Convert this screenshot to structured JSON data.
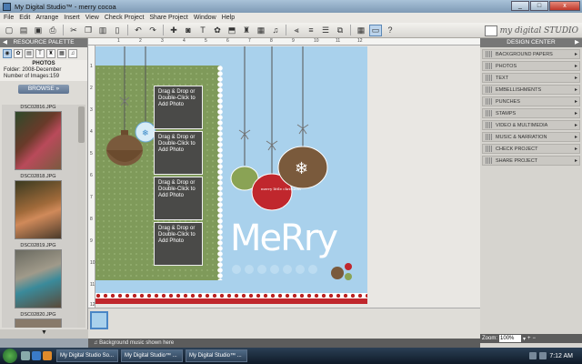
{
  "window": {
    "title": "My Digital Studio™ - merry cocoa"
  },
  "menu": [
    "File",
    "Edit",
    "Arrange",
    "Insert",
    "View",
    "Check Project",
    "Share Project",
    "Window",
    "Help"
  ],
  "window_buttons": {
    "minimize": "_",
    "maximize": "□",
    "close": "x"
  },
  "brand": {
    "text": "my digital STUDIO"
  },
  "resource_palette": {
    "title": "RESOURCE PALETTE",
    "section": "PHOTOS",
    "folder": "Folder: 2008-December",
    "count": "Number of Images:159",
    "browse_label": "BROWSE",
    "photos": [
      {
        "name": "DSC02816.JPG",
        "color": "#5a3a2a"
      },
      {
        "name": "DSC02818.JPG",
        "color": "#6a4a30"
      },
      {
        "name": "DSC02819.JPG",
        "color": "#6a6458"
      },
      {
        "name": "DSC02820.JPG",
        "color": "#887a6a"
      }
    ]
  },
  "canvas": {
    "ruler_top": [
      "1",
      "2",
      "3",
      "4",
      "5",
      "6",
      "7",
      "8",
      "9",
      "10",
      "11",
      "12"
    ],
    "ruler_left": [
      "1",
      "2",
      "3",
      "4",
      "5",
      "6",
      "7",
      "8",
      "9",
      "10",
      "11",
      "12"
    ],
    "photo_slots": [
      "Drag & Drop or Double-Click to Add Photo",
      "Drag & Drop or Double-Click to Add Photo",
      "Drag & Drop or Double-Click to Add Photo",
      "Drag & Drop or Double-Click to Add Photo"
    ],
    "title_text": "MeRry",
    "ornament_text": "merry little christmas"
  },
  "filmstrip": {
    "music_label": "Background music shown here"
  },
  "design_center": {
    "title": "DESIGN CENTER",
    "items": [
      "BACKGROUND PAPERS",
      "PHOTOS",
      "TEXT",
      "EMBELLISHMENTS",
      "PUNCHES",
      "STAMPS",
      "VIDEO & MULTIMEDIA",
      "MUSIC & NARRATION",
      "CHECK PROJECT",
      "SHARE PROJECT"
    ]
  },
  "zoom": {
    "label": "Zoom:",
    "value": "100%"
  },
  "taskbar": {
    "tasks": [
      "My Digital Studio So...",
      "My Digital Studio™ ...",
      "My Digital Studio™ ..."
    ],
    "time": "7:12 AM"
  },
  "colors": {
    "page_bg": "#a9d1ec",
    "green_paper": "#7f9a5a",
    "accent_red": "#c0272d",
    "brown": "#7a5a3c"
  }
}
